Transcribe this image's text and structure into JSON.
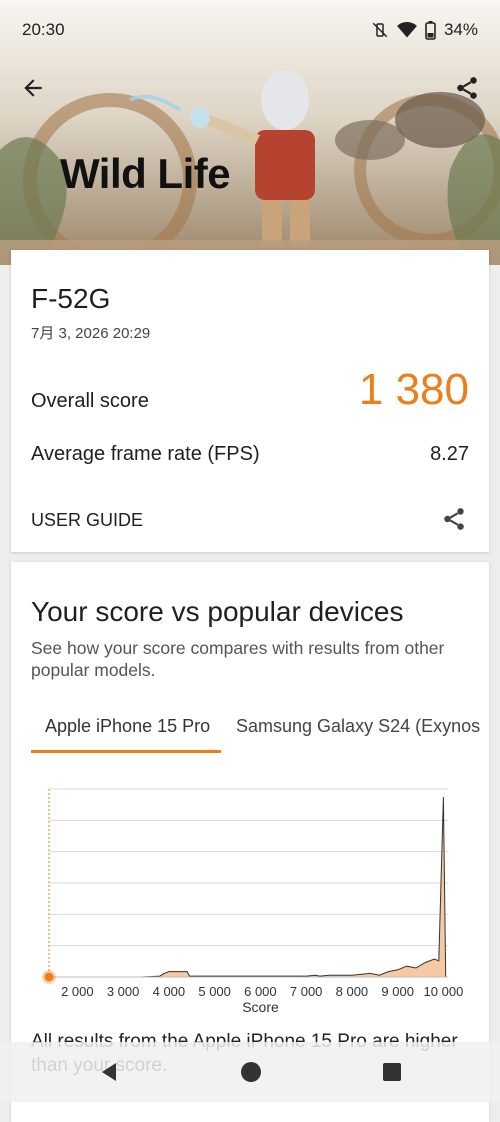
{
  "status_bar": {
    "time": "20:30",
    "battery": "34%"
  },
  "hero": {
    "title": "Wild Life"
  },
  "score_card": {
    "device": "F-52G",
    "date": "7月 3, 2026 20:29",
    "overall_label": "Overall score",
    "overall_value": "1 380",
    "fps_label": "Average frame rate (FPS)",
    "fps_value": "8.27",
    "guide_label": "USER GUIDE"
  },
  "compare": {
    "title": "Your score vs popular devices",
    "subtitle": "See how your score compares with results from other popular models.",
    "tabs": [
      "Apple iPhone 15 Pro",
      "Samsung Galaxy S24 (Exynos"
    ],
    "footnote": "All results from the Apple iPhone 15 Pro are higher than your score."
  },
  "chart_data": {
    "type": "area",
    "xlabel": "Score",
    "x_ticks": [
      2000,
      3000,
      4000,
      5000,
      6000,
      7000,
      8000,
      9000,
      10000
    ],
    "x_tick_labels": [
      "2 000",
      "3 000",
      "4 000",
      "5 000",
      "6 000",
      "7 000",
      "8 000",
      "9 000",
      "10 000"
    ],
    "xlim": [
      1380,
      10100
    ],
    "your_score": 1380,
    "grid": true,
    "x": [
      1380,
      3400,
      3800,
      3900,
      4000,
      4400,
      4450,
      5000,
      6000,
      7000,
      7200,
      7300,
      7500,
      8000,
      8400,
      8600,
      8800,
      9000,
      9200,
      9400,
      9600,
      9800,
      9900,
      10000,
      10050
    ],
    "y": [
      0,
      0,
      0.5,
      2,
      3,
      3,
      0.5,
      0.5,
      0.5,
      0.5,
      1,
      0.5,
      1,
      1,
      2,
      1,
      3,
      4,
      6,
      5,
      8,
      10,
      9,
      100,
      0
    ],
    "colors": {
      "fill": "#f5c9a4",
      "stroke": "#333333",
      "marker": "#ef7d1a",
      "grid": "#d9d9d9"
    }
  },
  "colors": {
    "accent": "#ef7d1a"
  }
}
